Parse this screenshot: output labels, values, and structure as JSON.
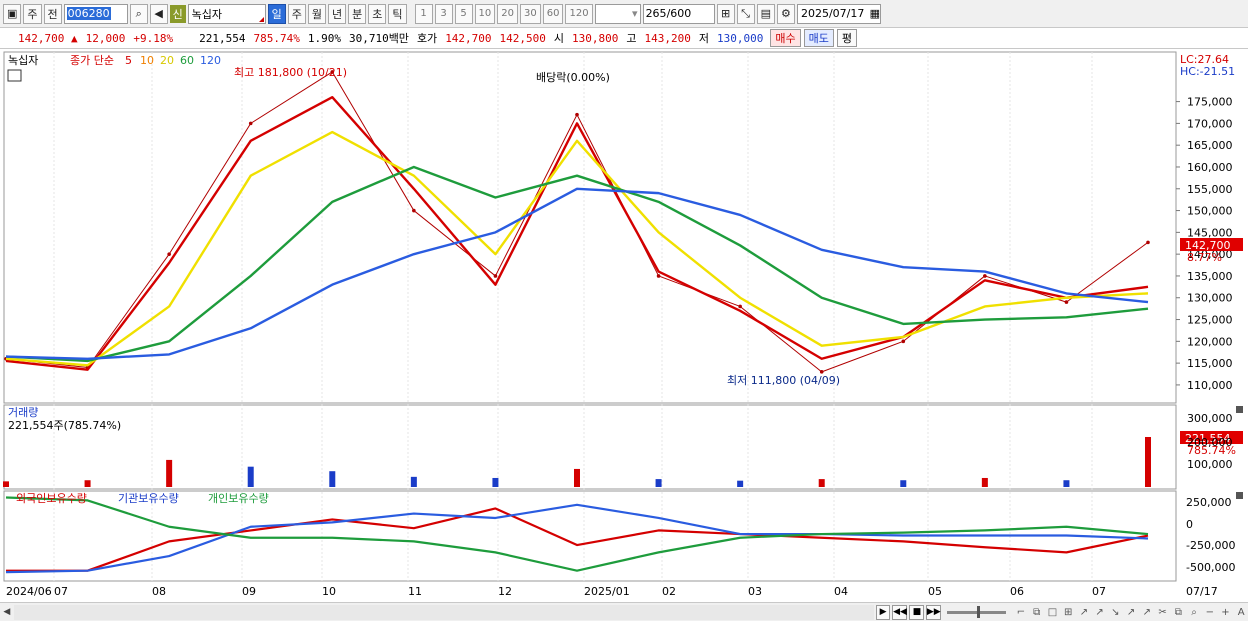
{
  "toolbar": {
    "mode": "주",
    "prev": "전",
    "code": "006280",
    "sin_badge": "신",
    "name": "녹십자",
    "periods": [
      "일",
      "주",
      "월",
      "년",
      "분",
      "초",
      "틱"
    ],
    "intervals": [
      "1",
      "3",
      "5",
      "10",
      "20",
      "30",
      "60",
      "120"
    ],
    "count": "265",
    "count_total": "/600",
    "date": "2025/07/17"
  },
  "infobar": {
    "price": "142,700",
    "arrow": "▲",
    "change": "12,000",
    "change_pct": "+9.18%",
    "volume": "221,554",
    "volume_pct": "785.74%",
    "turnover": "1.90%",
    "amount": "30,710백만",
    "hoga_label": "호가",
    "ask": "142,700",
    "bid": "142,500",
    "open_label": "시",
    "open": "130,800",
    "high_label": "고",
    "high": "143,200",
    "low_label": "저",
    "low": "130,000",
    "buy": "매수",
    "sell": "매도",
    "pyeong": "평"
  },
  "legend": {
    "name": "녹십자",
    "price_legend": "종가 단순",
    "ma": [
      "5",
      "10",
      "20",
      "60",
      "120"
    ],
    "ma_colors": [
      "#d40000",
      "#f08000",
      "#f0e000",
      "#1e9c3c",
      "#2a5ce0"
    ],
    "lc": "LC:27.64",
    "hc": "HC:-21.51"
  },
  "annotations": {
    "high": "최고 181,800 (10/21)",
    "low": "최저 111,800 (04/09)",
    "dividend": "배당락(0.00%)",
    "last_price": "142,700",
    "last_pct": "8.77%"
  },
  "volume_panel": {
    "title": "거래량",
    "value_label": "221,554주(785.74%)",
    "last": "221,554",
    "last_pct": "785.74%",
    "ticks": [
      "300,000",
      "200,000",
      "100,000"
    ]
  },
  "holdings_panel": {
    "series": [
      "외국인보유수량",
      "기관보유수량",
      "개인보유수량"
    ],
    "ticks": [
      "250,000",
      "0",
      "-250,000",
      "-500,000"
    ]
  },
  "x_axis": {
    "labels": [
      "2024/06",
      "07",
      "08",
      "09",
      "10",
      "11",
      "12",
      "2025/01",
      "02",
      "03",
      "04",
      "05",
      "06",
      "07"
    ],
    "end_label": "07/17"
  },
  "chart_data": [
    {
      "type": "line",
      "panel": "price",
      "x": [
        "2024/06",
        "07",
        "08",
        "09",
        "10",
        "11",
        "12",
        "2025/01",
        "02",
        "03",
        "04",
        "05",
        "06",
        "07",
        "07/17"
      ],
      "series": [
        {
          "name": "종가",
          "values": [
            116000,
            114000,
            140000,
            170000,
            181800,
            150000,
            135000,
            172000,
            135000,
            128000,
            113000,
            120000,
            135000,
            129000,
            142700
          ]
        },
        {
          "name": "5",
          "values": [
            115500,
            113500,
            138000,
            166000,
            176000,
            155000,
            133000,
            170000,
            136000,
            127000,
            116000,
            121000,
            134000,
            130000,
            132500
          ]
        },
        {
          "name": "20",
          "values": [
            116000,
            114500,
            128000,
            158000,
            168000,
            158000,
            140000,
            166000,
            145000,
            130000,
            119000,
            121000,
            128000,
            130000,
            131000
          ]
        },
        {
          "name": "60",
          "values": [
            116500,
            115500,
            120000,
            135000,
            152000,
            160000,
            153000,
            158000,
            152000,
            142000,
            130000,
            124000,
            125000,
            125500,
            127500
          ]
        },
        {
          "name": "120",
          "values": [
            116500,
            116000,
            117000,
            123000,
            133000,
            140000,
            145000,
            155000,
            154000,
            149000,
            141000,
            137000,
            136000,
            131000,
            129000
          ]
        }
      ],
      "ylim": [
        107000,
        185000
      ],
      "yticks": [
        "175,000",
        "170,000",
        "165,000",
        "160,000",
        "155,000",
        "150,000",
        "145,000",
        "140,000",
        "135,000",
        "130,000",
        "125,000",
        "120,000",
        "115,000",
        "110,000"
      ]
    },
    {
      "type": "bar",
      "panel": "volume",
      "categories": [
        "2024/06",
        "07",
        "08",
        "09",
        "10",
        "11",
        "12",
        "2025/01",
        "02",
        "03",
        "04",
        "05",
        "06",
        "07",
        "07/17"
      ],
      "values": [
        25000,
        30000,
        120000,
        90000,
        70000,
        45000,
        40000,
        80000,
        35000,
        28000,
        35000,
        30000,
        40000,
        30000,
        221554
      ],
      "ylim": [
        0,
        350000
      ]
    },
    {
      "type": "line",
      "panel": "holdings",
      "x": [
        "2024/06",
        "07",
        "08",
        "09",
        "10",
        "11",
        "12",
        "2025/01",
        "02",
        "03",
        "04",
        "05",
        "06",
        "07",
        "07/17"
      ],
      "series": [
        {
          "name": "외국인보유수량",
          "values": [
            -700000,
            -700000,
            -300000,
            -150000,
            0,
            -120000,
            150000,
            -350000,
            -150000,
            -200000,
            -250000,
            -300000,
            -380000,
            -450000,
            -220000
          ]
        },
        {
          "name": "기관보유수량",
          "values": [
            -720000,
            -700000,
            -500000,
            -100000,
            -40000,
            80000,
            20000,
            200000,
            20000,
            -200000,
            -200000,
            -220000,
            -220000,
            -220000,
            -260000
          ]
        },
        {
          "name": "개인보유수량",
          "values": [
            300000,
            260000,
            -100000,
            -250000,
            -250000,
            -300000,
            -450000,
            -700000,
            -450000,
            -250000,
            -200000,
            -180000,
            -150000,
            -100000,
            -200000
          ]
        }
      ],
      "ylim": [
        -800000,
        320000
      ]
    }
  ]
}
